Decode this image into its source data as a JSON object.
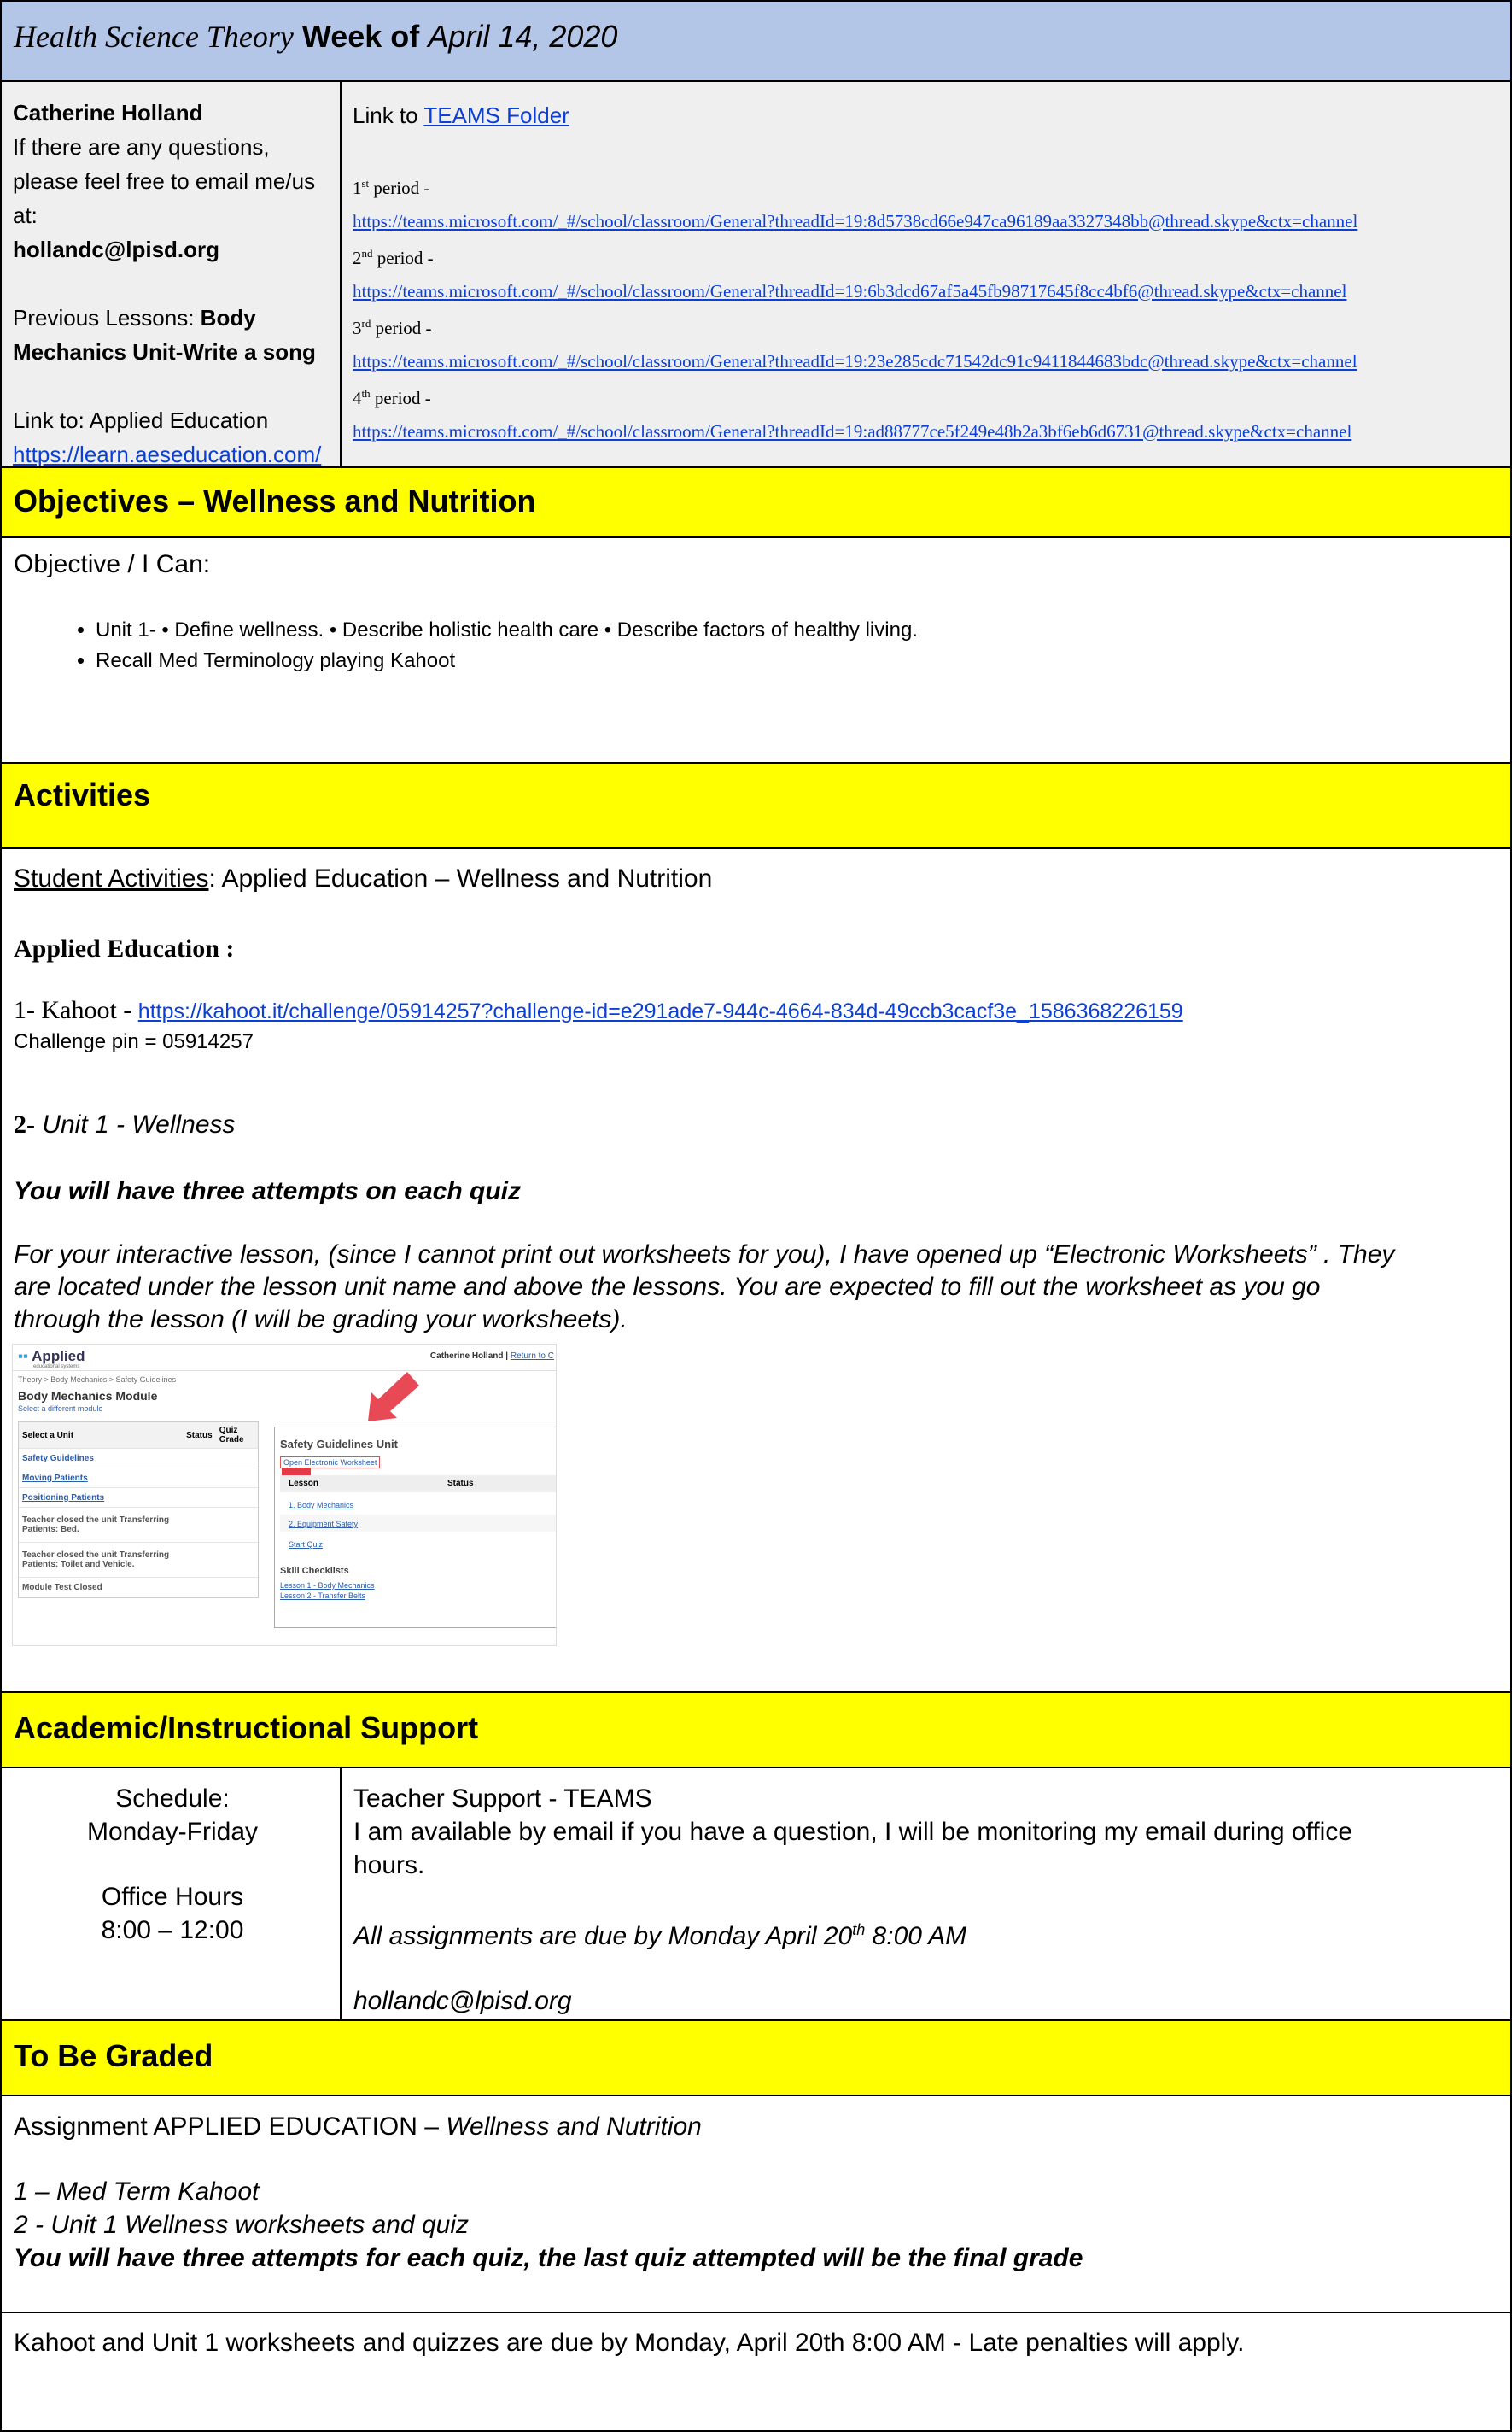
{
  "header": {
    "course": "Health Science Theory",
    "week_prefix": "Week of",
    "date": "April 14, 2020"
  },
  "teacher_info": {
    "name": "Catherine Holland",
    "questions_line1": "If there are any questions,",
    "questions_line2": "please feel free to email me/us",
    "questions_line3": "at:",
    "email": "hollandc@lpisd.org",
    "prev_label": "Previous Lessons: ",
    "prev_value_line1": "Body",
    "prev_value_line2": "Mechanics Unit-Write a song",
    "link_label": "Link to: Applied Education",
    "link_url": "https://learn.aeseducation.com/"
  },
  "teams": {
    "label": "Link to ",
    "folder_link": "TEAMS Folder",
    "periods": [
      {
        "num": "1",
        "sup": "st",
        "label": " period -",
        "url": "https://teams.microsoft.com/_#/school/classroom/General?threadId=19:8d5738cd66e947ca96189aa3327348bb@thread.skype&ctx=channel"
      },
      {
        "num": "2",
        "sup": "nd",
        "label": " period -",
        "url": "https://teams.microsoft.com/_#/school/classroom/General?threadId=19:6b3dcd67af5a45fb98717645f8cc4bf6@thread.skype&ctx=channel"
      },
      {
        "num": "3",
        "sup": "rd",
        "label": " period -",
        "url": "https://teams.microsoft.com/_#/school/classroom/General?threadId=19:23e285cdc71542dc91c9411844683bdc@thread.skype&ctx=channel"
      },
      {
        "num": "4",
        "sup": "th",
        "label": " period -",
        "url": "https://teams.microsoft.com/_#/school/classroom/General?threadId=19:ad88777ce5f249e48b2a3bf6eb6d6731@thread.skype&ctx=channel"
      }
    ]
  },
  "objectives": {
    "title": "Objectives – Wellness and Nutrition",
    "intro": "Objective / I Can:",
    "bullets": [
      "Unit 1- • Define wellness. • Describe holistic health care • Describe factors of healthy living.",
      "Recall Med Terminology playing Kahoot"
    ]
  },
  "activities": {
    "title": "Activities",
    "student_label": "Student Activities",
    "student_value": ":  Applied Education – Wellness and Nutrition",
    "applied_heading": "Applied Education :",
    "kahoot_prefix": "1- Kahoot - ",
    "kahoot_url": "https://kahoot.it/challenge/05914257?challenge-id=e291ade7-944c-4664-834d-49ccb3cacf3e_1586368226159",
    "challenge_pin": "Challenge pin = 05914257",
    "unit_num": "2-",
    "unit_name": " Unit 1 - Wellness",
    "attempts": "You will have three attempts on each quiz",
    "paragraph_lines": [
      "For your interactive lesson, (since I cannot print out worksheets for you), I have opened up “Electronic Worksheets” . They",
      "are located under the lesson unit name and above the lessons.  You are expected to fill out the worksheet as you go",
      "through the lesson (I will be grading your worksheets)."
    ],
    "screenshot": {
      "logo": "Applied",
      "logo_sub": "educational systems",
      "user": "Catherine Holland",
      "return": "Return to C",
      "breadcrumb": "Theory > Body Mechanics > Safety Guidelines",
      "module_title": "Body Mechanics Module",
      "module_link": "Select a different module",
      "table_header": [
        "Select a Unit",
        "Status",
        "Quiz Grade"
      ],
      "units": [
        "Safety Guidelines",
        "Moving Patients",
        "Positioning Patients"
      ],
      "closed": [
        "Teacher closed the unit Transferring Patients: Bed.",
        "Teacher closed the unit Transferring Patients: Toilet and Vehicle.",
        "Module Test Closed"
      ],
      "unit_title": "Safety Guidelines Unit",
      "worksheet": "Open Electronic Worksheet",
      "lesson_header": [
        "Lesson",
        "Status"
      ],
      "lessons": [
        "1. Body Mechanics",
        "2. Equipment Safety",
        "Start Quiz"
      ],
      "skill_title": "Skill Checklists",
      "skills": [
        "Lesson 1 - Body Mechanics",
        "Lesson 2 - Transfer Belts"
      ]
    }
  },
  "support": {
    "title": "Academic/Instructional Support",
    "schedule_label": "Schedule:",
    "schedule_days": "Monday-Friday",
    "office_label": "Office Hours",
    "office_time": "8:00 – 12:00",
    "teacher_support": "Teacher Support - TEAMS",
    "avail_line1": "I am available by email if you have a question, I will be monitoring my email during office",
    "avail_line2": "hours.",
    "due_text": "All assignments are due by Monday April 20",
    "due_sup": "th",
    "due_time": " 8:00 AM",
    "email": "hollandc@lpisd.org"
  },
  "graded": {
    "title": "To Be Graded",
    "assignment_prefix": "Assignment APPLIED EDUCATION – ",
    "assignment_topic": "Wellness and Nutrition",
    "item1": "1 – Med Term Kahoot",
    "item2": "2 - Unit 1 Wellness worksheets and quiz",
    "attempts": "You will have three attempts for each quiz, the last quiz attempted will be the final grade",
    "due_note": "Kahoot and Unit 1 worksheets and quizzes are due by Monday, April 20th 8:00 AM - Late penalties will apply."
  }
}
